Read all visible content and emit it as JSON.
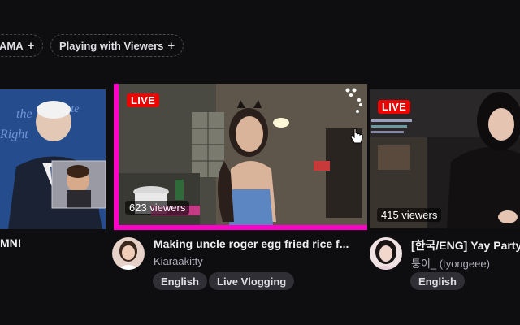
{
  "tags": [
    {
      "label": "AMA",
      "plus": "+"
    },
    {
      "label": "Playing with Viewers",
      "plus": "+"
    }
  ],
  "cards": [
    {
      "title": "MN!"
    },
    {
      "live": "LIVE",
      "viewers": "623 viewers",
      "title": "Making uncle roger egg fried rice f...",
      "channel": "Kiaraakitty",
      "tags": [
        "English",
        "Live Vlogging"
      ]
    },
    {
      "live": "LIVE",
      "viewers": "415 viewers",
      "title": "[한국/ENG] Yay Party",
      "channel": "퉁이_ (tyongeee)",
      "tags": [
        "English"
      ]
    }
  ],
  "colors": {
    "background": "#0e0e10",
    "live": "#eb0400",
    "highlight": "#ff00c8",
    "chip": "#2f2f35"
  }
}
